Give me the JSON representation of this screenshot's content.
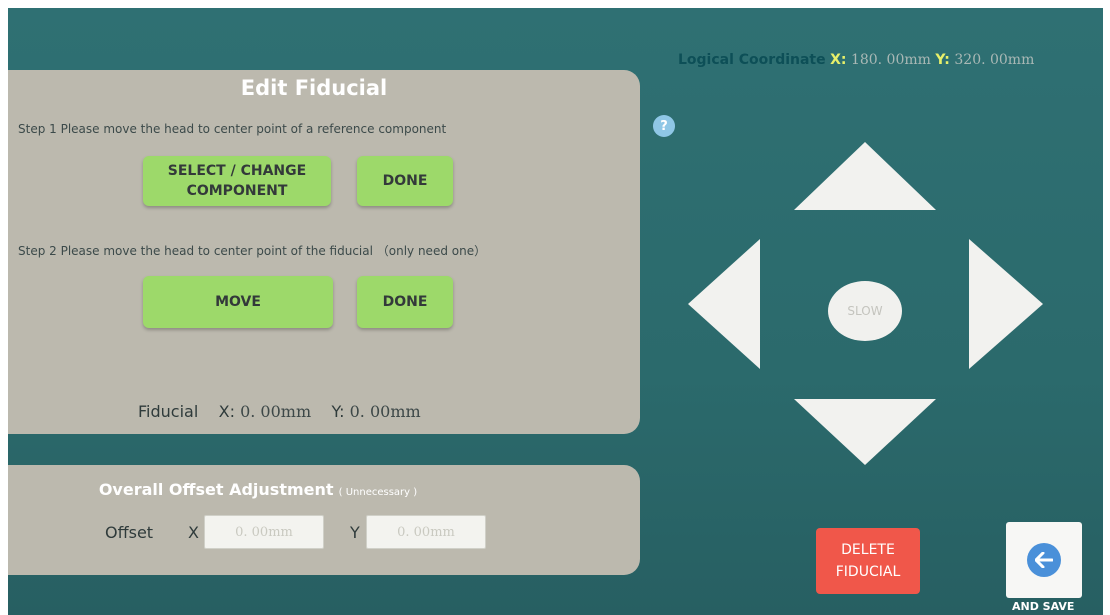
{
  "coordinate": {
    "label": "Logical Coordinate",
    "x_label": "X:",
    "x_value": "180. 00mm",
    "y_label": "Y:",
    "y_value": "320. 00mm"
  },
  "edit": {
    "title": "Edit Fiducial",
    "step1_text": "Step 1  Please move the head to center point of a reference component",
    "select_line1": "SELECT / CHANGE",
    "select_line2": "COMPONENT",
    "done1": "DONE",
    "step2_text": "Step 2  Please move the head to center point of  the fiducial （only need one）",
    "move": "MOVE",
    "done2": "DONE",
    "fiducial_label": "Fiducial",
    "fx_label": "X:",
    "fx_value": "0. 00mm",
    "fy_label": "Y:",
    "fy_value": "0. 00mm"
  },
  "offset": {
    "title": "Overall Offset Adjustment",
    "subtitle": "( Unnecessary )",
    "label": "Offset",
    "x_label": "X",
    "x_value": "0. 00mm",
    "y_label": "Y",
    "y_value": "0. 00mm"
  },
  "help": {
    "symbol": "?"
  },
  "jog": {
    "slow_label": "SLOW"
  },
  "delete": {
    "line1": "DELETE",
    "line2": "FIDUCIAL"
  },
  "back": {
    "label": "AND SAVE",
    "icon": "back-arrow-icon"
  },
  "colors": {
    "background": "#2d6d70",
    "panel": "#bcb9ae",
    "green_button": "#9dd96a",
    "delete_button": "#f0574a",
    "axis_yellow": "#e8f06a"
  }
}
